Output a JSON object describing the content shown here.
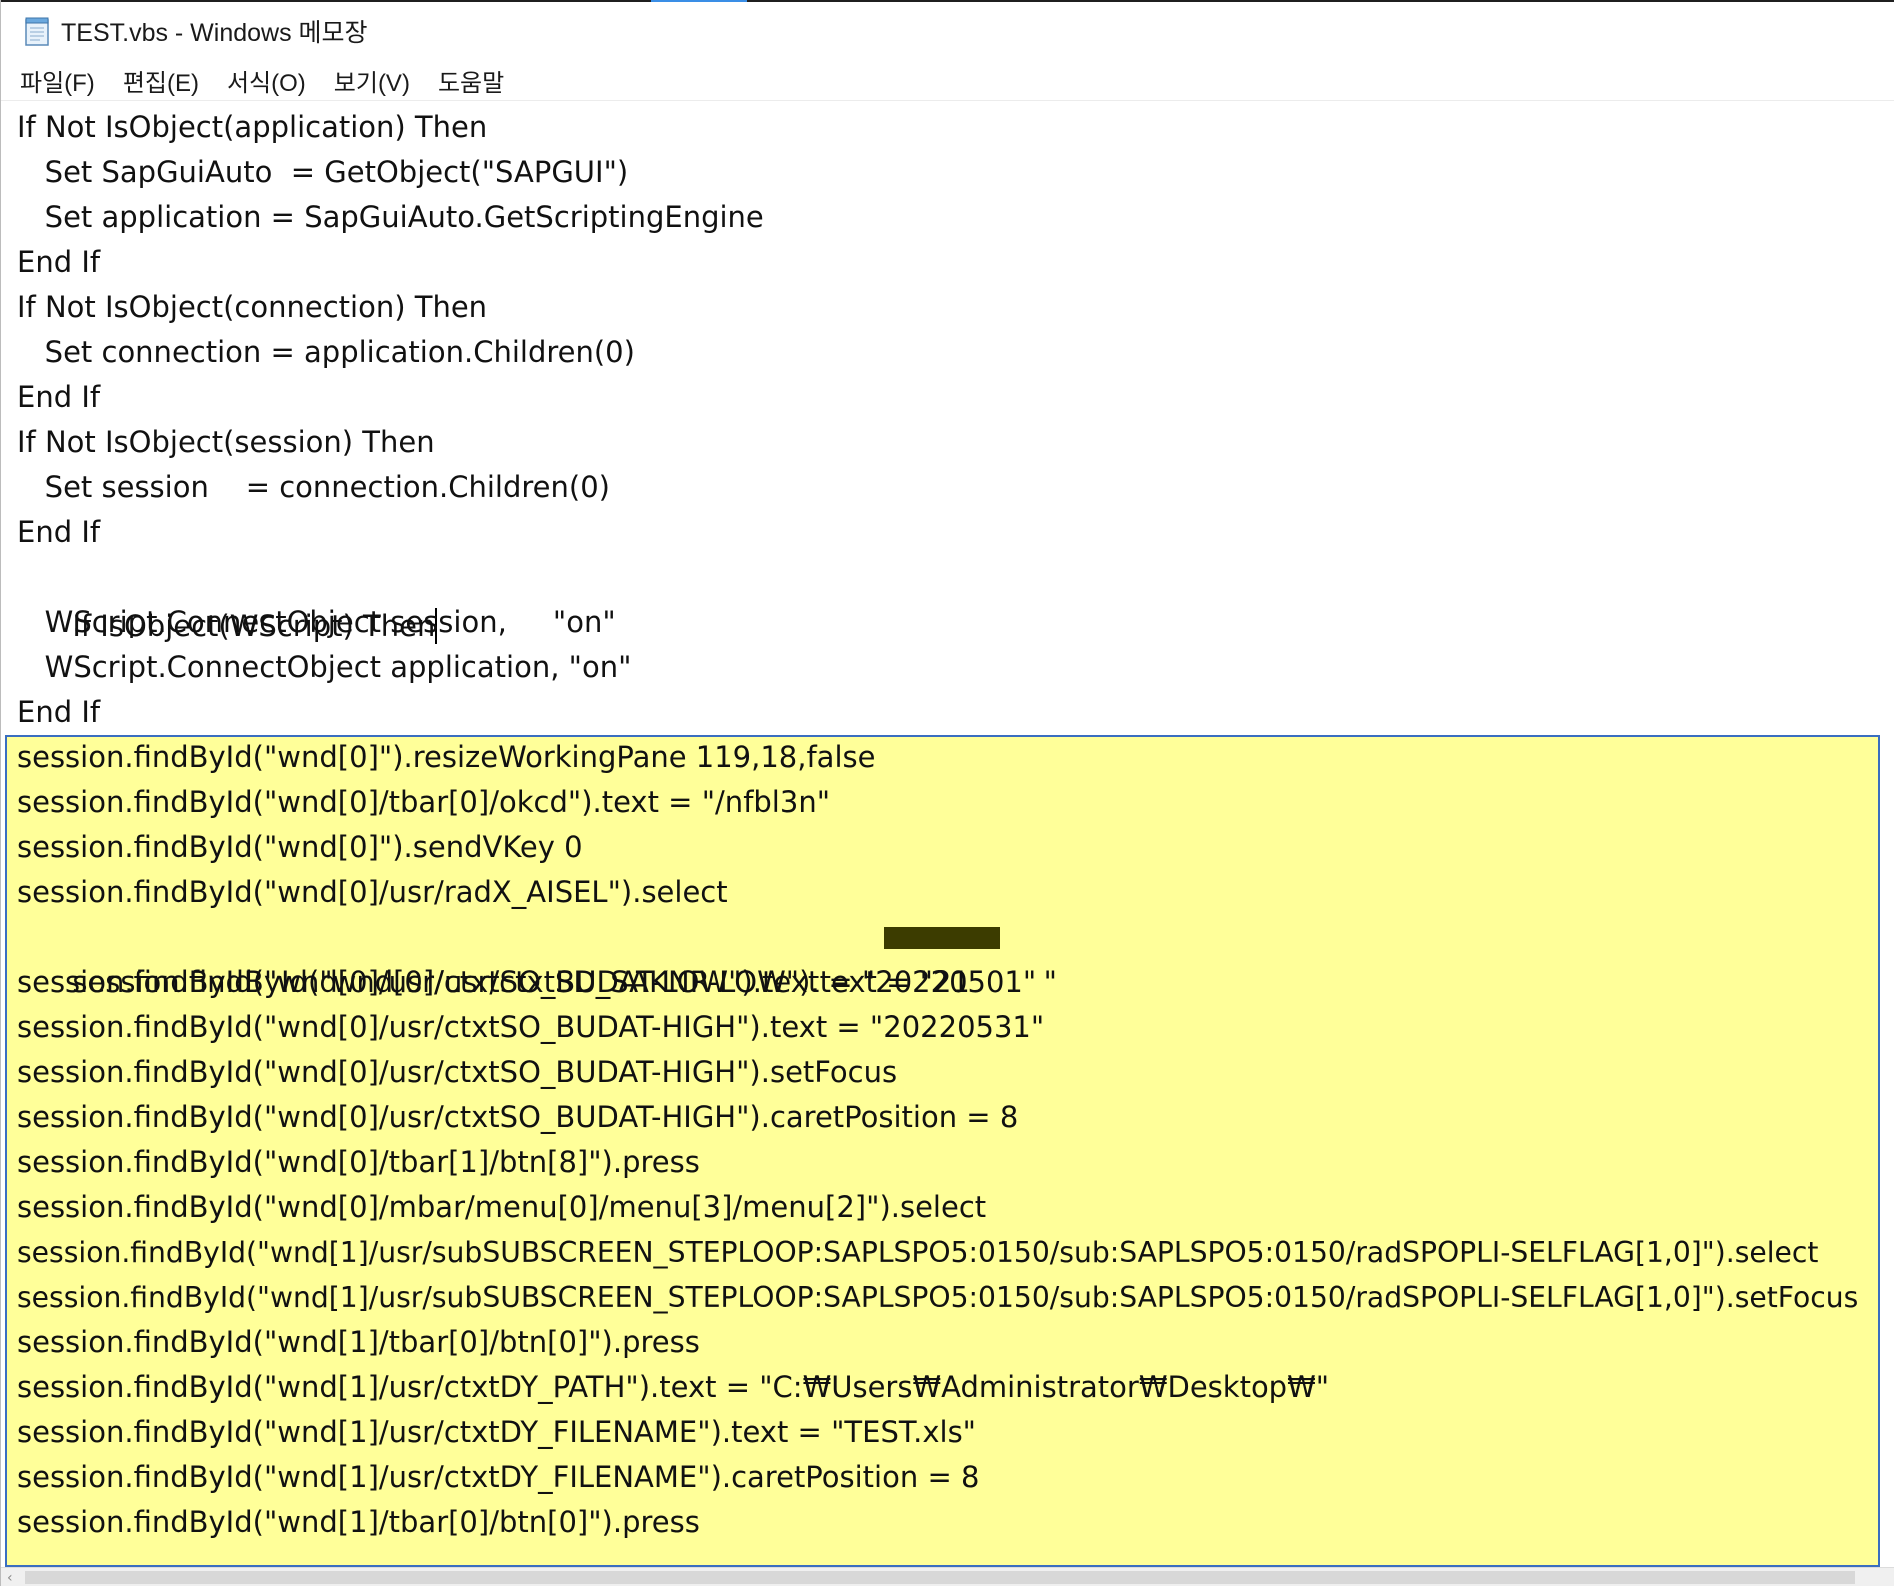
{
  "window": {
    "title": "TEST.vbs - Windows 메모장",
    "icon": "notepad-icon"
  },
  "menu": {
    "items": [
      "파일(F)",
      "편집(E)",
      "서식(O)",
      "보기(V)",
      "도움말"
    ]
  },
  "colors": {
    "selection_background": "#ffff99",
    "selection_border": "#3a6ec0",
    "text": "#111111"
  },
  "editor": {
    "lines": [
      "If Not IsObject(application) Then",
      "   Set SapGuiAuto  = GetObject(\"SAPGUI\")",
      "   Set application = SapGuiAuto.GetScriptingEngine",
      "End If",
      "If Not IsObject(connection) Then",
      "   Set connection = application.Children(0)",
      "End If",
      "If Not IsObject(session) Then",
      "   Set session    = connection.Children(0)",
      "End If",
      "If IsObject(WScript) Then",
      "   WScript.ConnectObject session,     \"on\"",
      "   WScript.ConnectObject application, \"on\"",
      "End If",
      "session.findById(\"wnd[0]\").resizeWorkingPane 119,18,false",
      "session.findById(\"wnd[0]/tbar[0]/okcd\").text = \"/nfbl3n\"",
      "session.findById(\"wnd[0]\").sendVKey 0",
      "session.findById(\"wnd[0]/usr/radX_AISEL\").select",
      "session.findById(\"wnd[0]/usr/ctxtSD_SAKNR-LOW\").text = \"21        \"",
      "session.findById(\"wnd[0]/usr/ctxtSO_BUDAT-LOW\").text = \"20220501\"",
      "session.findById(\"wnd[0]/usr/ctxtSO_BUDAT-HIGH\").text = \"20220531\"",
      "session.findById(\"wnd[0]/usr/ctxtSO_BUDAT-HIGH\").setFocus",
      "session.findById(\"wnd[0]/usr/ctxtSO_BUDAT-HIGH\").caretPosition = 8",
      "session.findById(\"wnd[0]/tbar[1]/btn[8]\").press",
      "session.findById(\"wnd[0]/mbar/menu[0]/menu[3]/menu[2]\").select",
      "session.findById(\"wnd[1]/usr/subSUBSCREEN_STEPLOOP:SAPLSPO5:0150/sub:SAPLSPO5:0150/radSPOPLI-SELFLAG[1,0]\").select",
      "session.findById(\"wnd[1]/usr/subSUBSCREEN_STEPLOOP:SAPLSPO5:0150/sub:SAPLSPO5:0150/radSPOPLI-SELFLAG[1,0]\").setFocus",
      "session.findById(\"wnd[1]/tbar[0]/btn[0]\").press",
      "session.findById(\"wnd[1]/usr/ctxtDY_PATH\").text = \"C:₩Users₩Administrator₩Desktop₩\"",
      "session.findById(\"wnd[1]/usr/ctxtDY_FILENAME\").text = \"TEST.xls\"",
      "session.findById(\"wnd[1]/usr/ctxtDY_FILENAME\").caretPosition = 8",
      "session.findById(\"wnd[1]/tbar[0]/btn[0]\").press"
    ]
  }
}
